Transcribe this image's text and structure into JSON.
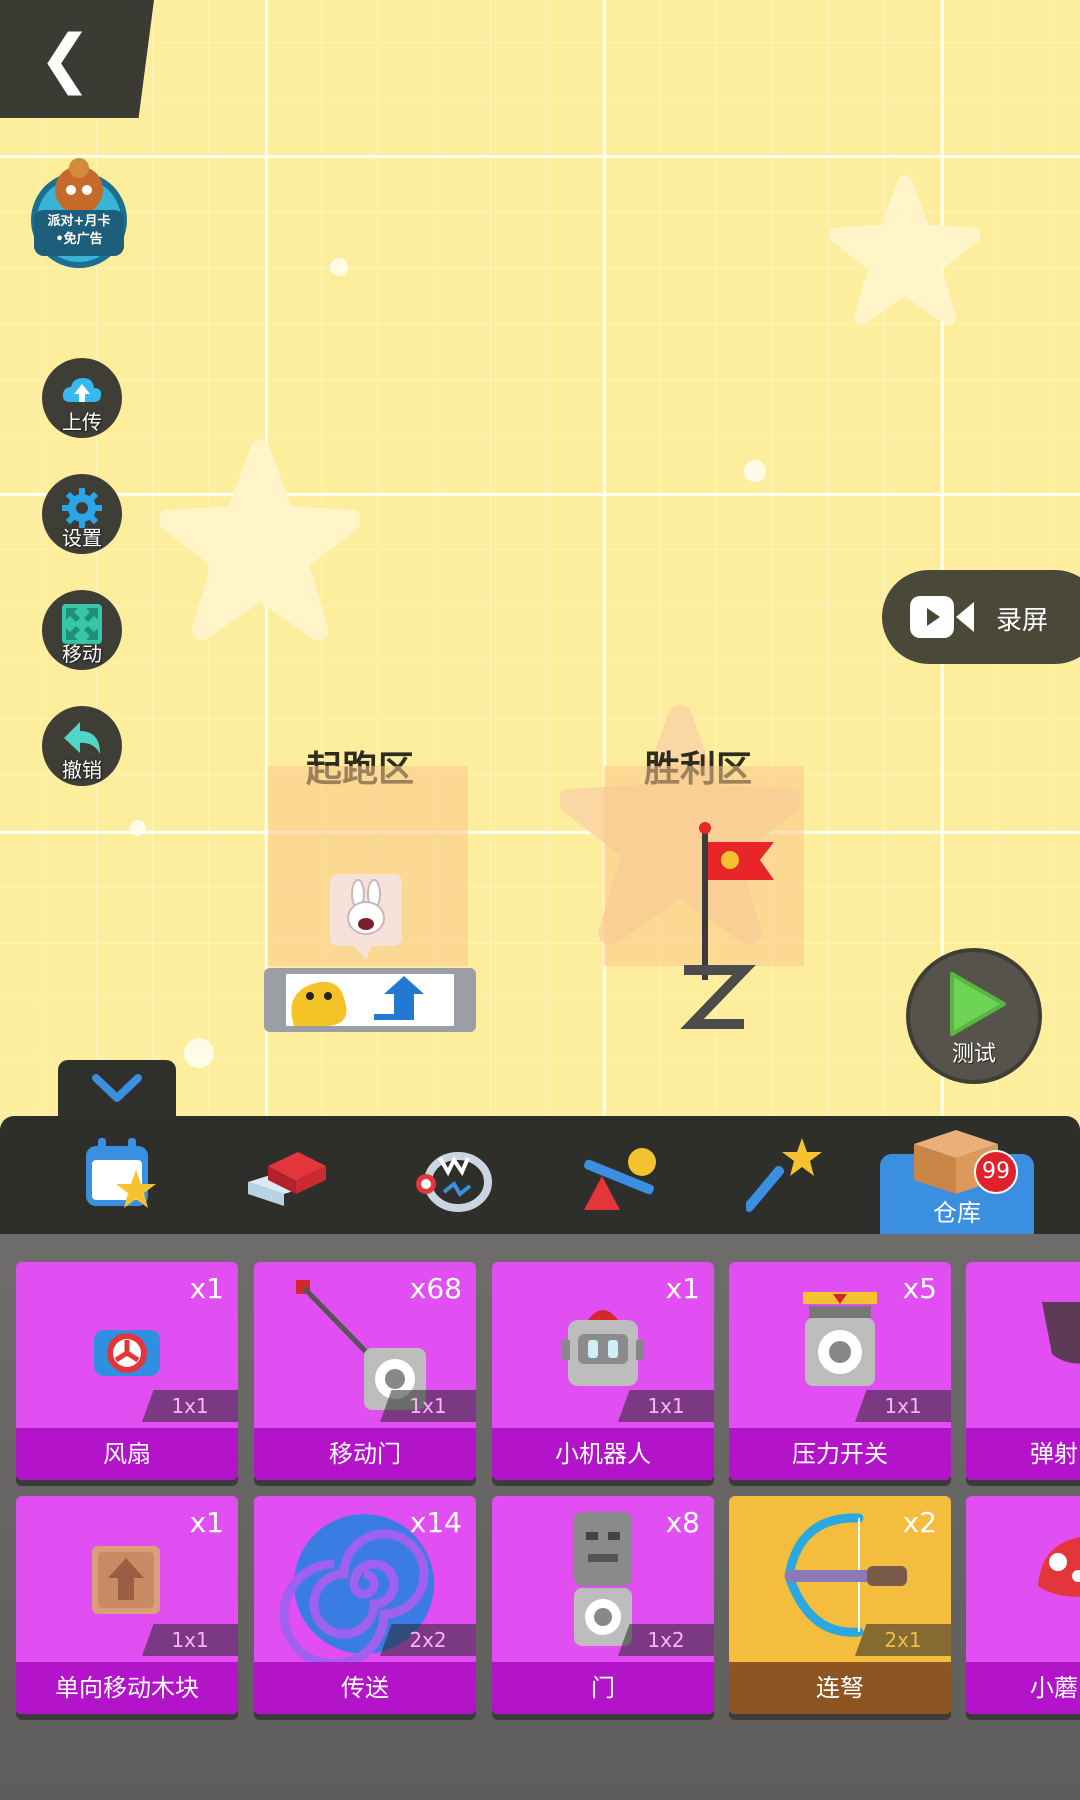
{
  "nav": {
    "back_icon": "chevron-left-icon",
    "back_glyph": "❮"
  },
  "promo": {
    "line1": "派对+月卡",
    "line2": "•免广告"
  },
  "side_buttons": [
    {
      "label": "上传",
      "icon": "cloud-upload-icon"
    },
    {
      "label": "设置",
      "icon": "gear-icon"
    },
    {
      "label": "移动",
      "icon": "move-arrows-icon"
    },
    {
      "label": "撤销",
      "icon": "undo-arrow-icon"
    }
  ],
  "record": {
    "label": "录屏",
    "icon": "video-camera-icon"
  },
  "test": {
    "label": "测试",
    "icon": "play-icon"
  },
  "zones": {
    "start": "起跑区",
    "victory": "胜利区"
  },
  "toolbar": {
    "tabs": [
      {
        "icon": "calendar-star-icon"
      },
      {
        "icon": "brick-block-icon"
      },
      {
        "icon": "bear-trap-icon"
      },
      {
        "icon": "seesaw-icon"
      },
      {
        "icon": "magic-wand-icon"
      }
    ],
    "storage": {
      "label": "仓库",
      "badge": "99",
      "icon": "cardboard-box-icon"
    }
  },
  "items": [
    {
      "name": "风扇",
      "count": "x1",
      "size": "1x1",
      "icon": "fan-icon"
    },
    {
      "name": "移动门",
      "count": "x68",
      "size": "1x1",
      "icon": "moving-door-icon"
    },
    {
      "name": "小机器人",
      "count": "x1",
      "size": "1x1",
      "icon": "robot-icon"
    },
    {
      "name": "压力开关",
      "count": "x5",
      "size": "1x1",
      "icon": "pressure-switch-icon"
    },
    {
      "name": "弹射",
      "count": "",
      "size": "",
      "icon": "catapult-icon"
    },
    {
      "name": "单向移动木块",
      "count": "x1",
      "size": "1x1",
      "icon": "one-way-block-icon"
    },
    {
      "name": "传送",
      "count": "x14",
      "size": "2x2",
      "icon": "portal-spiral-icon"
    },
    {
      "name": "门",
      "count": "x8",
      "size": "1x2",
      "icon": "totem-door-icon"
    },
    {
      "name": "连弩",
      "count": "x2",
      "size": "2x1",
      "icon": "crossbow-icon"
    },
    {
      "name": "小蘑",
      "count": "",
      "size": "",
      "icon": "mushroom-icon"
    }
  ]
}
